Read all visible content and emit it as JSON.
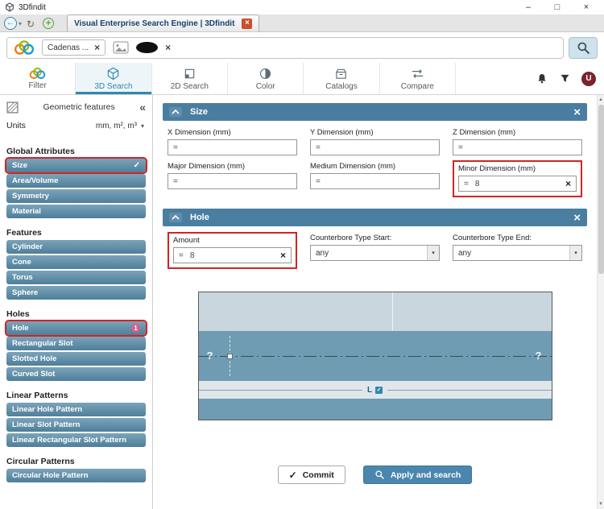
{
  "window": {
    "app_title": "3Dfindit"
  },
  "browser": {
    "tab_title": "Visual Enterprise Search Engine | 3Dfindit"
  },
  "searchbar": {
    "chip_label": "Cadenas ..."
  },
  "menubar": {
    "items": [
      {
        "label": "Filter"
      },
      {
        "label": "3D Search",
        "active": true
      },
      {
        "label": "2D Search"
      },
      {
        "label": "Color"
      },
      {
        "label": "Catalogs"
      },
      {
        "label": "Compare"
      }
    ]
  },
  "sidebar": {
    "header": "Geometric features",
    "units": {
      "label": "Units",
      "value": "mm, m², m³"
    },
    "sections": [
      {
        "title": "Global Attributes",
        "items": [
          {
            "label": "Size",
            "highlighted": true,
            "checked": true
          },
          {
            "label": "Area/Volume"
          },
          {
            "label": "Symmetry"
          },
          {
            "label": "Material"
          }
        ]
      },
      {
        "title": "Features",
        "items": [
          {
            "label": "Cylinder"
          },
          {
            "label": "Cone"
          },
          {
            "label": "Torus"
          },
          {
            "label": "Sphere"
          }
        ]
      },
      {
        "title": "Holes",
        "items": [
          {
            "label": "Hole",
            "highlighted": true,
            "badge": "1"
          },
          {
            "label": "Rectangular Slot"
          },
          {
            "label": "Slotted Hole"
          },
          {
            "label": "Curved Slot"
          }
        ]
      },
      {
        "title": "Linear Patterns",
        "items": [
          {
            "label": "Linear Hole Pattern"
          },
          {
            "label": "Linear Slot Pattern"
          },
          {
            "label": "Linear Rectangular Slot Pattern"
          }
        ]
      },
      {
        "title": "Circular Patterns",
        "items": [
          {
            "label": "Circular Hole Pattern"
          }
        ]
      }
    ]
  },
  "size_panel": {
    "title": "Size",
    "fields": [
      {
        "label": "X Dimension (mm)",
        "operator": "=",
        "value": ""
      },
      {
        "label": "Y Dimension (mm)",
        "operator": "=",
        "value": ""
      },
      {
        "label": "Z Dimension (mm)",
        "operator": "=",
        "value": ""
      },
      {
        "label": "Major Dimension (mm)",
        "operator": "=",
        "value": ""
      },
      {
        "label": "Medium Dimension (mm)",
        "operator": "=",
        "value": ""
      },
      {
        "label": "Minor Dimension (mm)",
        "operator": "=",
        "value": "8",
        "highlighted": true
      }
    ]
  },
  "hole_panel": {
    "title": "Hole",
    "amount": {
      "label": "Amount",
      "operator": "=",
      "value": "8",
      "highlighted": true
    },
    "counterbore_start": {
      "label": "Counterbore Type Start:",
      "value": "any"
    },
    "counterbore_end": {
      "label": "Counterbore Type End:",
      "value": "any"
    },
    "diagram": {
      "left_mark": "?",
      "right_mark": "?",
      "length_label": "L"
    }
  },
  "footer": {
    "commit": "Commit",
    "apply": "Apply and search"
  },
  "icons": {
    "minimize": "–",
    "maximize": "□",
    "close": "×",
    "back": "←",
    "caret": "▾",
    "refresh": "↻",
    "plus": "+",
    "collapse": "«",
    "check": "✓",
    "clear": "×",
    "scroll_up": "▲",
    "scroll_down": "▼"
  },
  "colors": {
    "panel_header": "#4a7ea1",
    "sidebar_button": "#4e7f9b",
    "highlight_red": "#d42323",
    "active_menu": "#3287ae",
    "user_badge": "#7b222c",
    "diagram_blue": "#6f9cb2"
  }
}
